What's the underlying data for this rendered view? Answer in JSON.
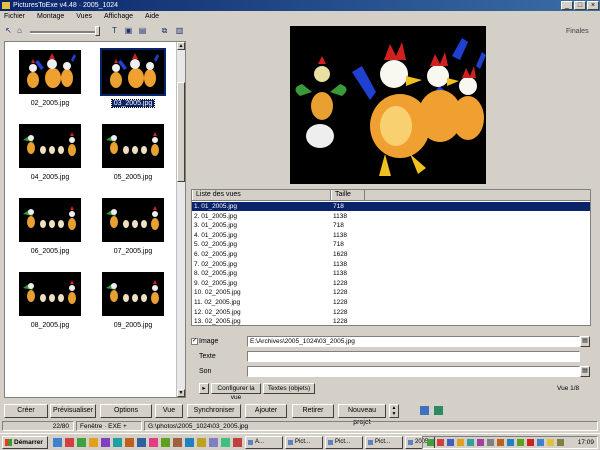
{
  "window": {
    "title": "PicturesToExe v4.48 · 2005_1024"
  },
  "menu": {
    "items": [
      "Fichier",
      "Montage",
      "Vues",
      "Affichage",
      "Aide"
    ]
  },
  "toolbar": {
    "top_right_label": "Finales"
  },
  "thumbnails": [
    {
      "caption": "02_2005.jpg",
      "selected": false
    },
    {
      "caption": "03_2005.jpg",
      "selected": true
    },
    {
      "caption": "04_2005.jpg",
      "selected": false
    },
    {
      "caption": "05_2005.jpg",
      "selected": false
    },
    {
      "caption": "06_2005.jpg",
      "selected": false
    },
    {
      "caption": "07_2005.jpg",
      "selected": false
    },
    {
      "caption": "08_2005.jpg",
      "selected": false
    },
    {
      "caption": "09_2005.jpg",
      "selected": false
    }
  ],
  "file_list": {
    "columns": [
      "Liste des vues",
      "Taille"
    ],
    "rows": [
      {
        "name": "1. 01_2005.jpg",
        "size": "718",
        "selected": true
      },
      {
        "name": "2. 01_2005.jpg",
        "size": "1138"
      },
      {
        "name": "3. 01_2005.jpg",
        "size": "718"
      },
      {
        "name": "4. 01_2005.jpg",
        "size": "1138"
      },
      {
        "name": "5. 02_2005.jpg",
        "size": "718"
      },
      {
        "name": "6. 02_2005.jpg",
        "size": "1628"
      },
      {
        "name": "7. 02_2005.jpg",
        "size": "1138"
      },
      {
        "name": "8. 02_2005.jpg",
        "size": "1138"
      },
      {
        "name": "9. 02_2005.jpg",
        "size": "1228"
      },
      {
        "name": "10. 02_2005.jpg",
        "size": "1228"
      },
      {
        "name": "11. 02_2005.jpg",
        "size": "1228"
      },
      {
        "name": "12. 02_2005.jpg",
        "size": "1228"
      },
      {
        "name": "13. 02_2005.jpg",
        "size": "1228"
      }
    ]
  },
  "fields": {
    "image_label": "Image",
    "image_value": "E:\\Archives\\2005_1024\\03_2005.jpg",
    "texte_label": "Texte",
    "texte_value": "",
    "son_label": "Son",
    "son_value": "",
    "config_button": "Configurer la vue",
    "objects_button": "Textes (objets)",
    "right_label": "Vue 1/8"
  },
  "bottom_buttons": [
    "Créer",
    "Prévisualiser",
    "Options",
    "Vue",
    "Synchroniser",
    "Ajouter",
    "Retirer",
    "Nouveau projet"
  ],
  "status": {
    "count": "22/80",
    "mode": "Fenêtre · EXE + CODE",
    "path": "G:\\photos\\2005_1024\\03_2005.jpg"
  },
  "taskbar": {
    "start_label": "Démarrer",
    "tasks": [
      "A...",
      "Pict...",
      "Pict...",
      "Pict...",
      "2005...",
      "2005..."
    ],
    "active_task_index": 5,
    "clock": "17:09"
  }
}
